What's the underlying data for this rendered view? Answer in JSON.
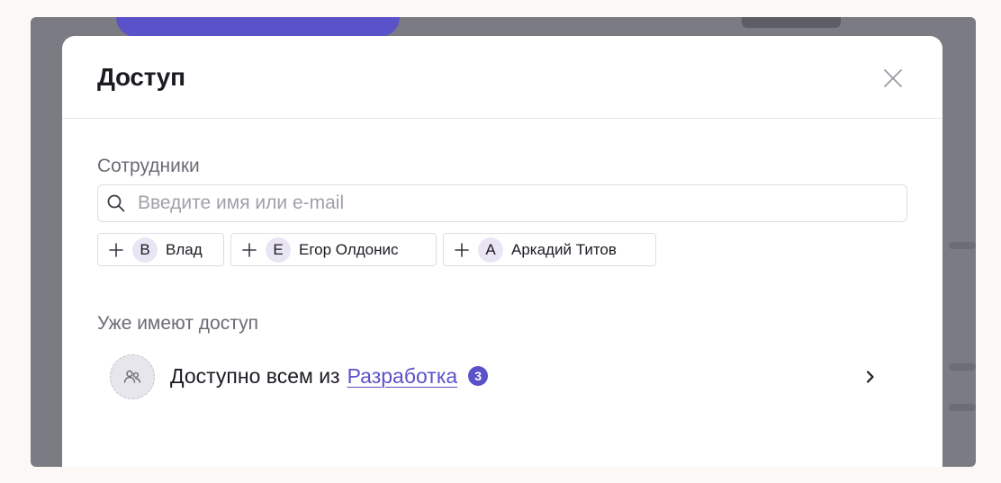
{
  "modal": {
    "title": "Доступ",
    "close_icon": "close-icon"
  },
  "employees": {
    "label": "Сотрудники",
    "search_placeholder": "Введите имя или e-mail",
    "search_value": "",
    "search_icon": "search-icon",
    "suggestions": [
      {
        "initial": "В",
        "name": "Влад"
      },
      {
        "initial": "Е",
        "name": "Егор Олдонис"
      },
      {
        "initial": "А",
        "name": "Аркадий Титов"
      }
    ]
  },
  "access": {
    "label": "Уже имеют доступ",
    "row": {
      "icon": "users-icon",
      "text": "Доступно всем из",
      "group_link": "Разработка",
      "count": "3",
      "chevron_icon": "chevron-right-icon"
    }
  },
  "colors": {
    "accent": "#5a52c8",
    "overlay": "#7b7b83",
    "avatar_bg": "#eae5f4"
  }
}
